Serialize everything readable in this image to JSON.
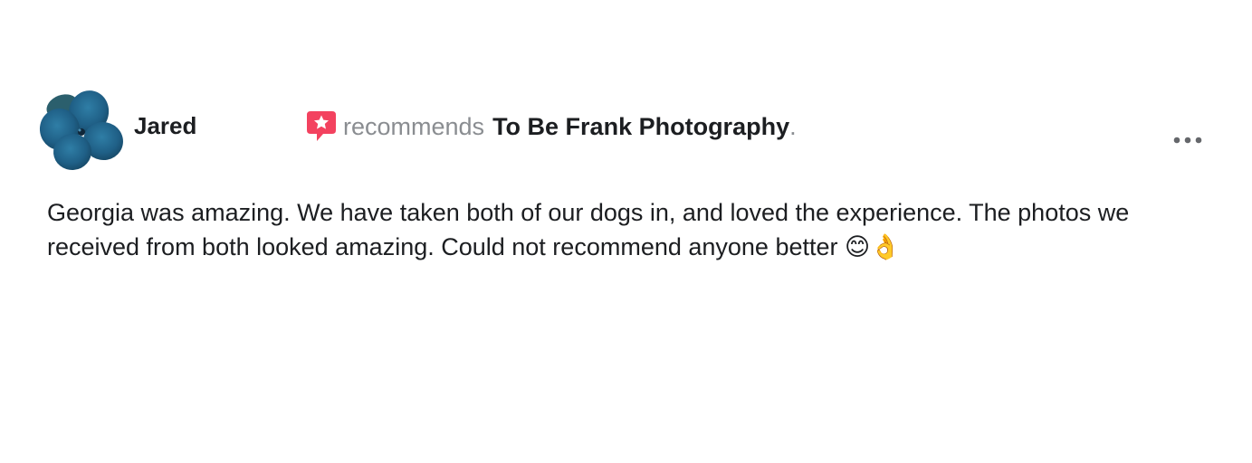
{
  "post": {
    "author": "Jared",
    "avatar": "flower-avatar",
    "action_icon": "recommendation-star-icon",
    "action_text": "recommends",
    "page_name": "To Be Frank Photography",
    "punctuation": ".",
    "more_icon": "more-options-icon",
    "review_text": "Georgia was amazing. We have taken both of our dogs in, and loved the experience. The photos we received from both looked amazing. Could not recommend anyone better 😊👌"
  },
  "colors": {
    "recommend_icon": "#f3425f",
    "secondary_text": "#8a8d91",
    "primary_text": "#1c1e21",
    "avatar_petal": "#1f5f86"
  }
}
